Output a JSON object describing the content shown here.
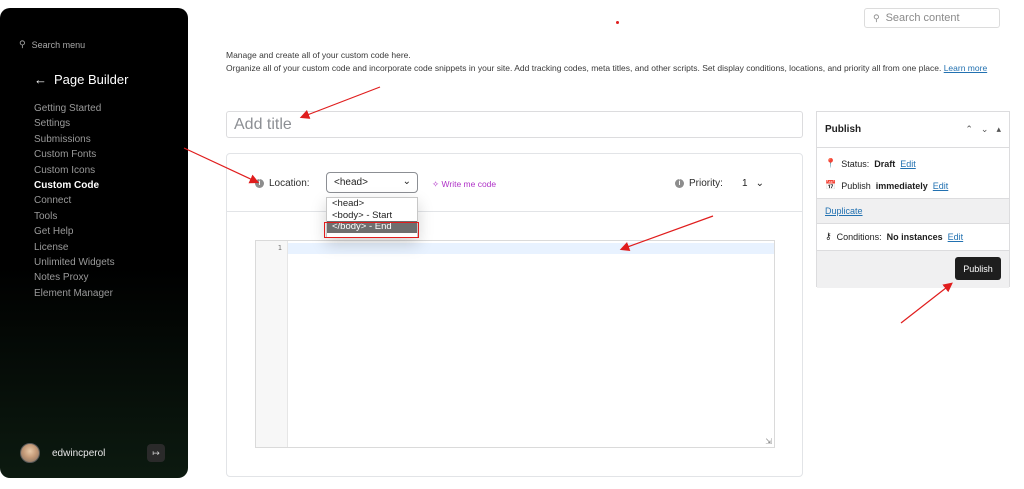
{
  "sidebar": {
    "search_placeholder": "Search menu",
    "back_title": "Page Builder",
    "items": [
      {
        "label": "Getting Started"
      },
      {
        "label": "Settings"
      },
      {
        "label": "Submissions"
      },
      {
        "label": "Custom Fonts"
      },
      {
        "label": "Custom Icons"
      },
      {
        "label": "Custom Code",
        "active": true
      },
      {
        "label": "Connect"
      },
      {
        "label": "Tools"
      },
      {
        "label": "Get Help"
      },
      {
        "label": "License"
      },
      {
        "label": "Unlimited Widgets"
      },
      {
        "label": "Notes Proxy"
      },
      {
        "label": "Element Manager"
      }
    ],
    "username": "edwincperol"
  },
  "header": {
    "search_placeholder": "Search content"
  },
  "description": {
    "line1": "Manage and create all of your custom code here.",
    "line2": "Organize all of your custom code and incorporate code snippets in your site. Add tracking codes, meta titles, and other scripts. Set display conditions, locations, and priority all from one place.",
    "learn_more": "Learn more"
  },
  "editor": {
    "title_placeholder": "Add title",
    "location_label": "Location:",
    "location_value": "<head>",
    "location_options": [
      "<head>",
      "<body> - Start",
      "</body> - End"
    ],
    "write_me_code": "Write me code",
    "priority_label": "Priority:",
    "priority_value": "1",
    "line_number": "1"
  },
  "publish": {
    "title": "Publish",
    "status_label": "Status:",
    "status_value": "Draft",
    "edit": "Edit",
    "publish_label": "Publish",
    "publish_value": "immediately",
    "duplicate": "Duplicate",
    "conditions_label": "Conditions:",
    "conditions_value": "No instances",
    "button": "Publish"
  },
  "colors": {
    "accent_link": "#2271b1",
    "ai_purple": "#b033c8",
    "annotation_red": "#e01d1d"
  }
}
